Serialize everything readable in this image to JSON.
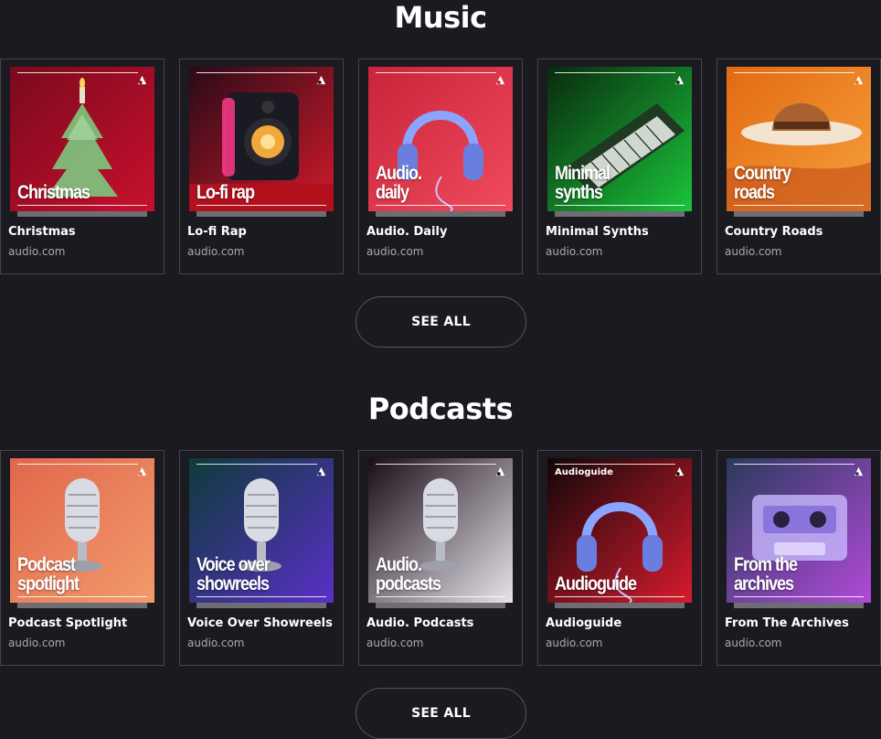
{
  "music": {
    "title": "Music",
    "see_all": "SEE ALL",
    "cards": [
      {
        "title": "Christmas",
        "source": "audio.com",
        "art_label": "Christmas",
        "art_small": "",
        "icon": "christmas-tree-candle-icon",
        "colors": [
          "#7a0a1c",
          "#c8102e"
        ]
      },
      {
        "title": "Lo-fi Rap",
        "source": "audio.com",
        "art_label": "Lo-fi rap",
        "art_small": "",
        "icon": "speaker-icon",
        "colors": [
          "#2a0a18",
          "#d11a2a"
        ]
      },
      {
        "title": "Audio. Daily",
        "source": "audio.com",
        "art_label": "Audio.\ndaily",
        "art_small": "",
        "icon": "headphones-icon",
        "colors": [
          "#c9243b",
          "#f04a5c"
        ]
      },
      {
        "title": "Minimal Synths",
        "source": "audio.com",
        "art_label": "Minimal\nsynths",
        "art_small": "",
        "icon": "synthesizer-icon",
        "colors": [
          "#0a2a0e",
          "#19c43a"
        ]
      },
      {
        "title": "Country Roads",
        "source": "audio.com",
        "art_label": "Country\nroads",
        "art_small": "",
        "icon": "cowboy-hat-icon",
        "colors": [
          "#e36a12",
          "#f5a03c"
        ]
      }
    ]
  },
  "podcasts": {
    "title": "Podcasts",
    "see_all": "SEE ALL",
    "cards": [
      {
        "title": "Podcast Spotlight",
        "source": "audio.com",
        "art_label": "Podcast\nspotlight",
        "art_small": "",
        "icon": "microphone-icon",
        "colors": [
          "#e0674c",
          "#f29a6b"
        ]
      },
      {
        "title": "Voice Over Showreels",
        "source": "audio.com",
        "art_label": "Voice over\nshowreels",
        "art_small": "",
        "icon": "microphone-icon",
        "colors": [
          "#0d3b3a",
          "#5a2fc8"
        ]
      },
      {
        "title": "Audio. Podcasts",
        "source": "audio.com",
        "art_label": "Audio.\npodcasts",
        "art_small": "",
        "icon": "microphone-icon",
        "colors": [
          "#1a0d18",
          "#e8e4ea"
        ]
      },
      {
        "title": "Audioguide",
        "source": "audio.com",
        "art_label": "Audioguide",
        "art_small": "Audioguide",
        "icon": "headphones-icon",
        "colors": [
          "#120608",
          "#d61c2e"
        ]
      },
      {
        "title": "From The Archives",
        "source": "audio.com",
        "art_label": "From the\narchives",
        "art_small": "",
        "icon": "cassette-icon",
        "colors": [
          "#2a3a5c",
          "#b04ad8"
        ]
      }
    ]
  }
}
